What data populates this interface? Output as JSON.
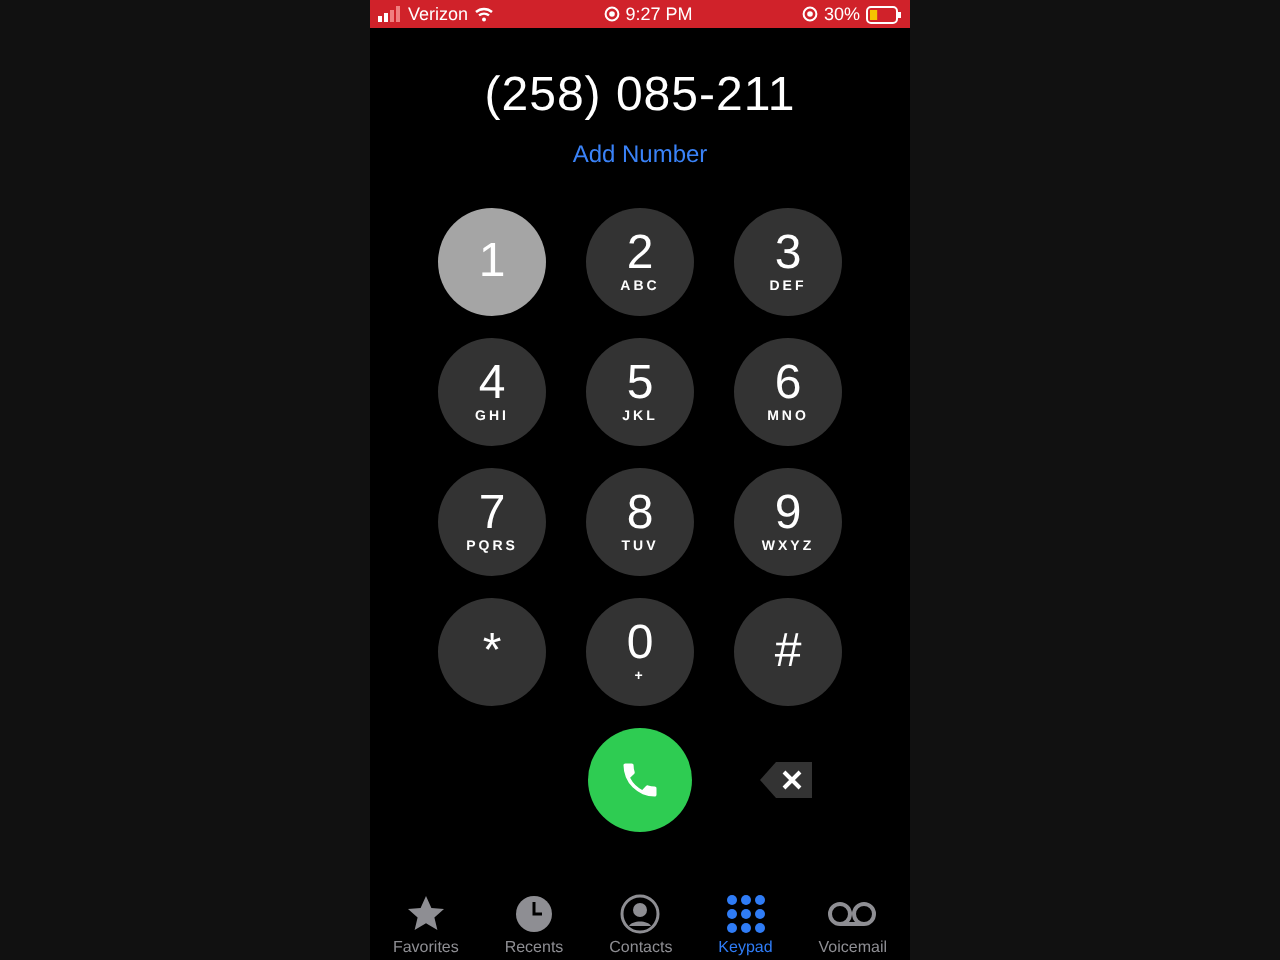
{
  "status_bar": {
    "carrier": "Verizon",
    "time": "9:27 PM",
    "battery": "30%",
    "level": 0.3
  },
  "dialed_number": "(258) 085-211",
  "add_number_link": "Add Number",
  "keys": [
    {
      "digit": "1",
      "pressed": true
    },
    {
      "digit": "2",
      "letters": "ABC",
      "pressed": false
    },
    {
      "digit": "3",
      "letters": "DEF",
      "pressed": false
    },
    {
      "digit": "4",
      "letters": "GHI",
      "pressed": false
    },
    {
      "digit": "5",
      "letters": "JKL",
      "pressed": false
    },
    {
      "digit": "6",
      "letters": "MNO",
      "pressed": false
    },
    {
      "digit": "7",
      "letters": "PQRS",
      "pressed": false
    },
    {
      "digit": "8",
      "letters": "TUV",
      "pressed": false
    },
    {
      "digit": "9",
      "letters": "WXYZ",
      "pressed": false
    },
    {
      "digit": "*",
      "pressed": false
    },
    {
      "digit": "0",
      "letters": "+",
      "pressed": false
    },
    {
      "digit": "#",
      "pressed": false
    }
  ],
  "tabs": [
    {
      "label": "Favorites",
      "kind": "star",
      "selected": false
    },
    {
      "label": "Recents",
      "kind": "clock",
      "selected": false
    },
    {
      "label": "Contacts",
      "kind": "person",
      "selected": false
    },
    {
      "label": "Keypad",
      "kind": "keypad",
      "selected": true
    },
    {
      "label": "Voicemail",
      "kind": "voicemail",
      "selected": false
    }
  ]
}
